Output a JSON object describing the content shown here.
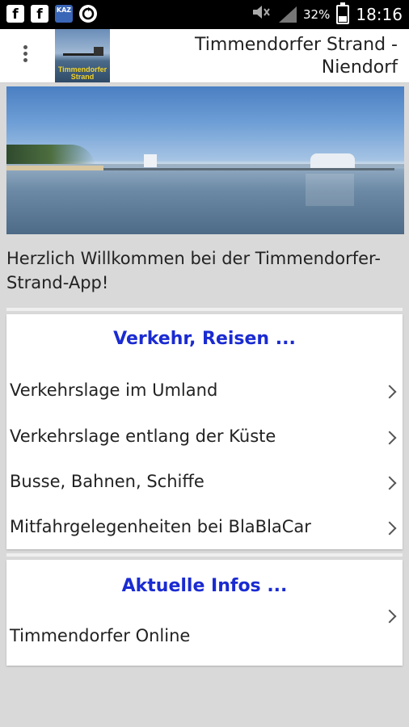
{
  "status_bar": {
    "icons_left": [
      "facebook-icon",
      "facebook-icon",
      "kaz-app-icon",
      "sync-icon"
    ],
    "fb1": "f",
    "fb2": "f",
    "kaz": "KAZ",
    "battery": "32%",
    "time": "18:16"
  },
  "app_bar": {
    "title": "Timmendorfer Strand - Niendorf",
    "logo_text": "Timmendorfer Strand"
  },
  "welcome": "Herzlich Willkommen bei der Timmendorfer-Strand-App!",
  "sections": [
    {
      "heading": "Verkehr, Reisen ...",
      "items": [
        "Verkehrslage im Umland",
        "Verkehrslage entlang der Küste",
        "Busse, Bahnen, Schiffe",
        "Mitfahrgelegenheiten bei BlaBlaCar"
      ]
    },
    {
      "heading": "Aktuelle Infos ...",
      "items": [
        "Timmendorfer Online"
      ]
    }
  ],
  "colors": {
    "section_heading": "#1a2bd1",
    "background": "#d9d9d9"
  }
}
